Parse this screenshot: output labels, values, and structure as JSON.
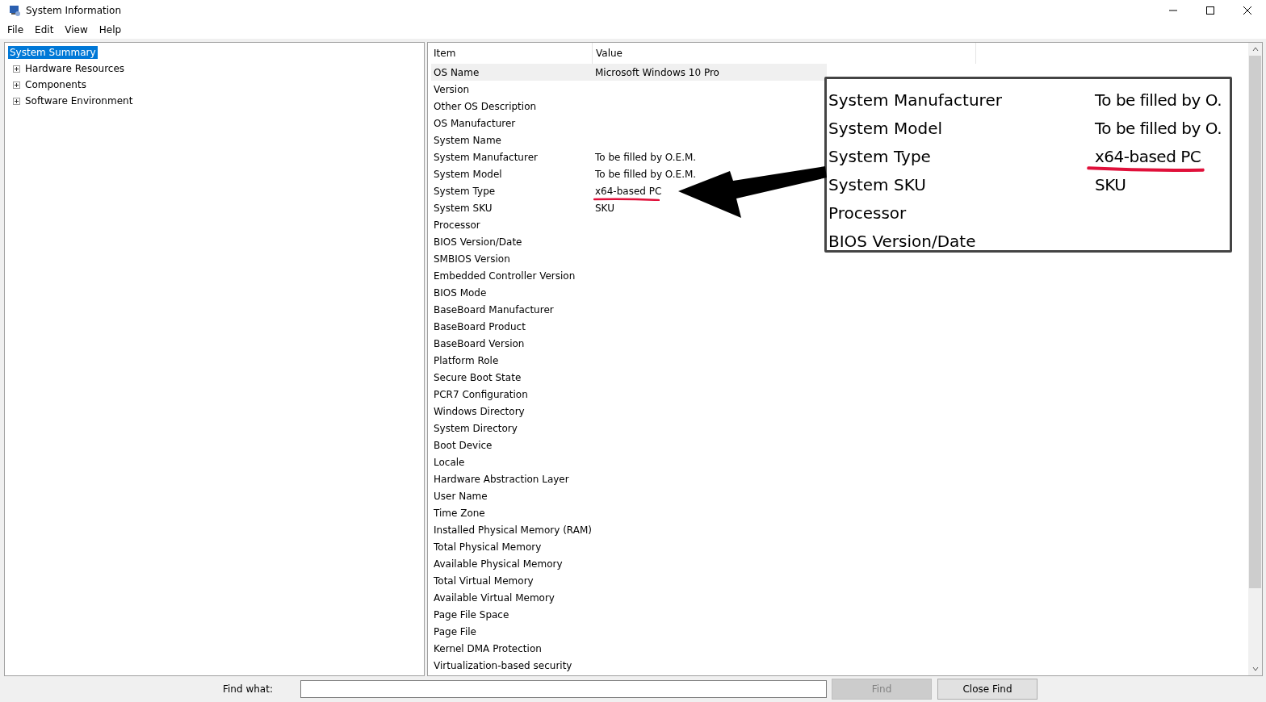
{
  "window": {
    "title": "System Information"
  },
  "menu": [
    "File",
    "Edit",
    "View",
    "Help"
  ],
  "tree": [
    {
      "label": "System Summary",
      "selected": true,
      "expandable": false
    },
    {
      "label": "Hardware Resources",
      "selected": false,
      "expandable": true
    },
    {
      "label": "Components",
      "selected": false,
      "expandable": true
    },
    {
      "label": "Software Environment",
      "selected": false,
      "expandable": true
    }
  ],
  "table": {
    "columns": [
      "Item",
      "Value"
    ],
    "rows": [
      {
        "item": "OS Name",
        "value": "Microsoft Windows 10 Pro",
        "selected": true,
        "underlined": false
      },
      {
        "item": "Version",
        "value": "",
        "selected": false,
        "underlined": false
      },
      {
        "item": "Other OS Description",
        "value": "",
        "selected": false,
        "underlined": false
      },
      {
        "item": "OS Manufacturer",
        "value": "",
        "selected": false,
        "underlined": false
      },
      {
        "item": "System Name",
        "value": "",
        "selected": false,
        "underlined": false
      },
      {
        "item": "System Manufacturer",
        "value": "To be filled by O.E.M.",
        "selected": false,
        "underlined": false
      },
      {
        "item": "System Model",
        "value": "To be filled by O.E.M.",
        "selected": false,
        "underlined": false
      },
      {
        "item": "System Type",
        "value": "x64-based PC",
        "selected": false,
        "underlined": true
      },
      {
        "item": "System SKU",
        "value": "SKU",
        "selected": false,
        "underlined": false
      },
      {
        "item": "Processor",
        "value": "",
        "selected": false,
        "underlined": false
      },
      {
        "item": "BIOS Version/Date",
        "value": "",
        "selected": false,
        "underlined": false
      },
      {
        "item": "SMBIOS Version",
        "value": "",
        "selected": false,
        "underlined": false
      },
      {
        "item": "Embedded Controller Version",
        "value": "",
        "selected": false,
        "underlined": false
      },
      {
        "item": "BIOS Mode",
        "value": "",
        "selected": false,
        "underlined": false
      },
      {
        "item": "BaseBoard Manufacturer",
        "value": "",
        "selected": false,
        "underlined": false
      },
      {
        "item": "BaseBoard Product",
        "value": "",
        "selected": false,
        "underlined": false
      },
      {
        "item": "BaseBoard Version",
        "value": "",
        "selected": false,
        "underlined": false
      },
      {
        "item": "Platform Role",
        "value": "",
        "selected": false,
        "underlined": false
      },
      {
        "item": "Secure Boot State",
        "value": "",
        "selected": false,
        "underlined": false
      },
      {
        "item": "PCR7 Configuration",
        "value": "",
        "selected": false,
        "underlined": false
      },
      {
        "item": "Windows Directory",
        "value": "",
        "selected": false,
        "underlined": false
      },
      {
        "item": "System Directory",
        "value": "",
        "selected": false,
        "underlined": false
      },
      {
        "item": "Boot Device",
        "value": "",
        "selected": false,
        "underlined": false
      },
      {
        "item": "Locale",
        "value": "",
        "selected": false,
        "underlined": false
      },
      {
        "item": "Hardware Abstraction Layer",
        "value": "",
        "selected": false,
        "underlined": false
      },
      {
        "item": "User Name",
        "value": "",
        "selected": false,
        "underlined": false
      },
      {
        "item": "Time Zone",
        "value": "",
        "selected": false,
        "underlined": false
      },
      {
        "item": "Installed Physical Memory (RAM)",
        "value": "",
        "selected": false,
        "underlined": false
      },
      {
        "item": "Total Physical Memory",
        "value": "",
        "selected": false,
        "underlined": false
      },
      {
        "item": "Available Physical Memory",
        "value": "",
        "selected": false,
        "underlined": false
      },
      {
        "item": "Total Virtual Memory",
        "value": "",
        "selected": false,
        "underlined": false
      },
      {
        "item": "Available Virtual Memory",
        "value": "",
        "selected": false,
        "underlined": false
      },
      {
        "item": "Page File Space",
        "value": "",
        "selected": false,
        "underlined": false
      },
      {
        "item": "Page File",
        "value": "",
        "selected": false,
        "underlined": false
      },
      {
        "item": "Kernel DMA Protection",
        "value": "",
        "selected": false,
        "underlined": false
      },
      {
        "item": "Virtualization-based security",
        "value": "",
        "selected": false,
        "underlined": false
      }
    ]
  },
  "callout": {
    "rows": [
      {
        "item": "System Manufacturer",
        "value": "To be filled by O.",
        "underlined": false
      },
      {
        "item": "System Model",
        "value": "To be filled by O.",
        "underlined": false
      },
      {
        "item": "System Type",
        "value": "x64-based PC",
        "underlined": true
      },
      {
        "item": "System SKU",
        "value": "SKU",
        "underlined": false
      },
      {
        "item": "Processor",
        "value": "",
        "underlined": false
      },
      {
        "item": "BIOS Version/Date",
        "value": "",
        "underlined": false
      }
    ]
  },
  "find": {
    "label": "Find what:",
    "buttons": [
      {
        "label": "Find",
        "disabled": true
      },
      {
        "label": "Close Find",
        "disabled": false
      }
    ]
  }
}
